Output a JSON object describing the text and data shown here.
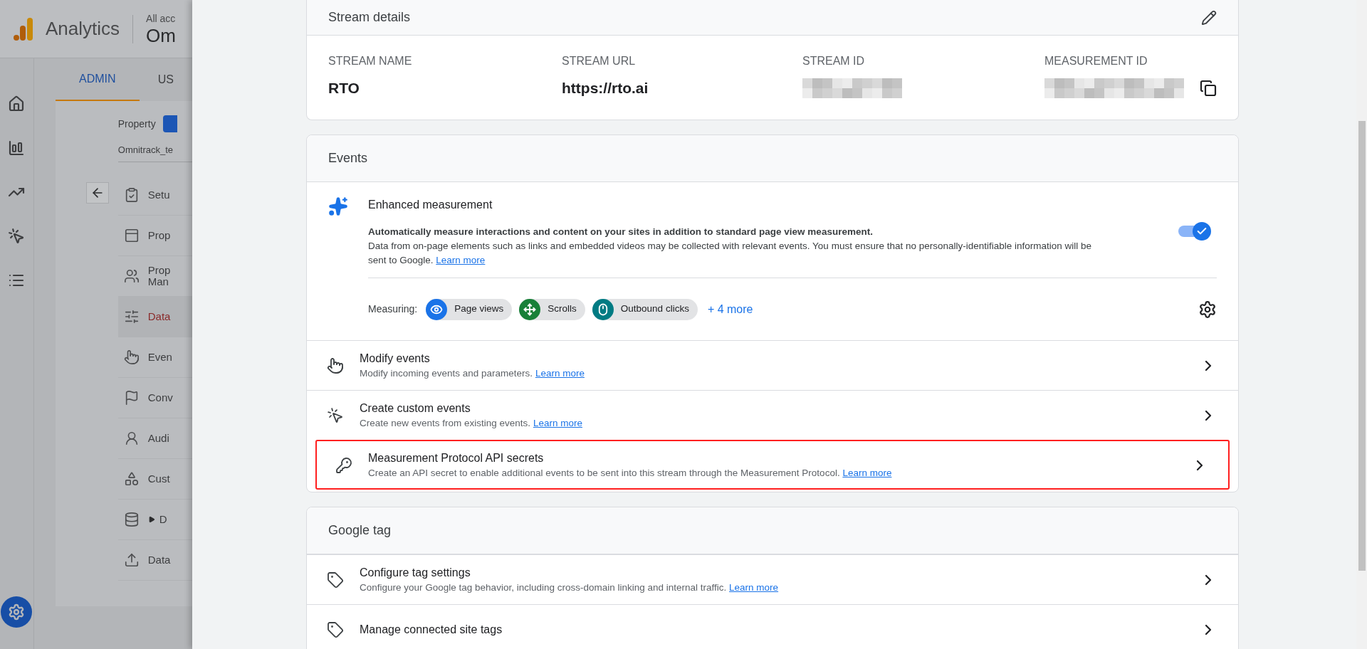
{
  "app": {
    "name": "Analytics",
    "account_label": "All acc",
    "property_name": "Om"
  },
  "admin": {
    "tabs": [
      {
        "label": "ADMIN",
        "selected": true
      },
      {
        "label": "US",
        "selected": false
      }
    ],
    "property_label": "Property",
    "property_name": "Omnitrack_te",
    "nav": [
      {
        "lines": [
          "Setu"
        ],
        "selected": false
      },
      {
        "lines": [
          "Prop"
        ],
        "selected": false
      },
      {
        "lines": [
          "Prop",
          "Man"
        ],
        "selected": false
      },
      {
        "lines": [
          "Data"
        ],
        "selected": true
      },
      {
        "lines": [
          "Even"
        ],
        "selected": false
      },
      {
        "lines": [
          "Conv"
        ],
        "selected": false
      },
      {
        "lines": [
          "Audi"
        ],
        "selected": false
      },
      {
        "lines": [
          "Cust"
        ],
        "selected": false
      },
      {
        "lines": [
          "D"
        ],
        "selected": false,
        "expandable": true
      },
      {
        "lines": [
          "Data"
        ],
        "selected": false
      }
    ]
  },
  "stream_details": {
    "title": "Stream details",
    "fields": [
      {
        "label": "STREAM NAME",
        "value": "RTO",
        "redacted": false,
        "copyable": false
      },
      {
        "label": "STREAM URL",
        "value": "https://rto.ai",
        "redacted": false,
        "copyable": false
      },
      {
        "label": "STREAM ID",
        "redacted": true,
        "copyable": false
      },
      {
        "label": "MEASUREMENT ID",
        "redacted": true,
        "copyable": true
      }
    ]
  },
  "events": {
    "title": "Events",
    "enhanced": {
      "title": "Enhanced measurement",
      "lead": "Automatically measure interactions and content on your sites in addition to standard page view measurement.",
      "body": "Data from on-page elements such as links and embedded videos may be collected with relevant events. You must ensure that no personally-identifiable information will be sent to Google.",
      "link": "Learn more",
      "on": true,
      "measuring_label": "Measuring:",
      "chips": [
        {
          "label": "Page views",
          "color": "#1a73e8"
        },
        {
          "label": "Scrolls",
          "color": "#188038"
        },
        {
          "label": "Outbound clicks",
          "color": "#007b83"
        }
      ],
      "more": "+ 4 more"
    },
    "rows": [
      {
        "title": "Modify events",
        "description": "Modify incoming events and parameters.",
        "link": "Learn more",
        "highlighted": false
      },
      {
        "title": "Create custom events",
        "description": "Create new events from existing events.",
        "link": "Learn more",
        "highlighted": false
      },
      {
        "title": "Measurement Protocol API secrets",
        "description": "Create an API secret to enable additional events to be sent into this stream through the Measurement Protocol.",
        "link": "Learn more",
        "highlighted": true
      }
    ]
  },
  "google_tag": {
    "title": "Google tag",
    "rows": [
      {
        "title": "Configure tag settings",
        "description": "Configure your Google tag behavior, including cross-domain linking and internal traffic.",
        "link": "Learn more",
        "highlighted": false
      },
      {
        "title": "Manage connected site tags",
        "highlighted": false
      }
    ]
  }
}
